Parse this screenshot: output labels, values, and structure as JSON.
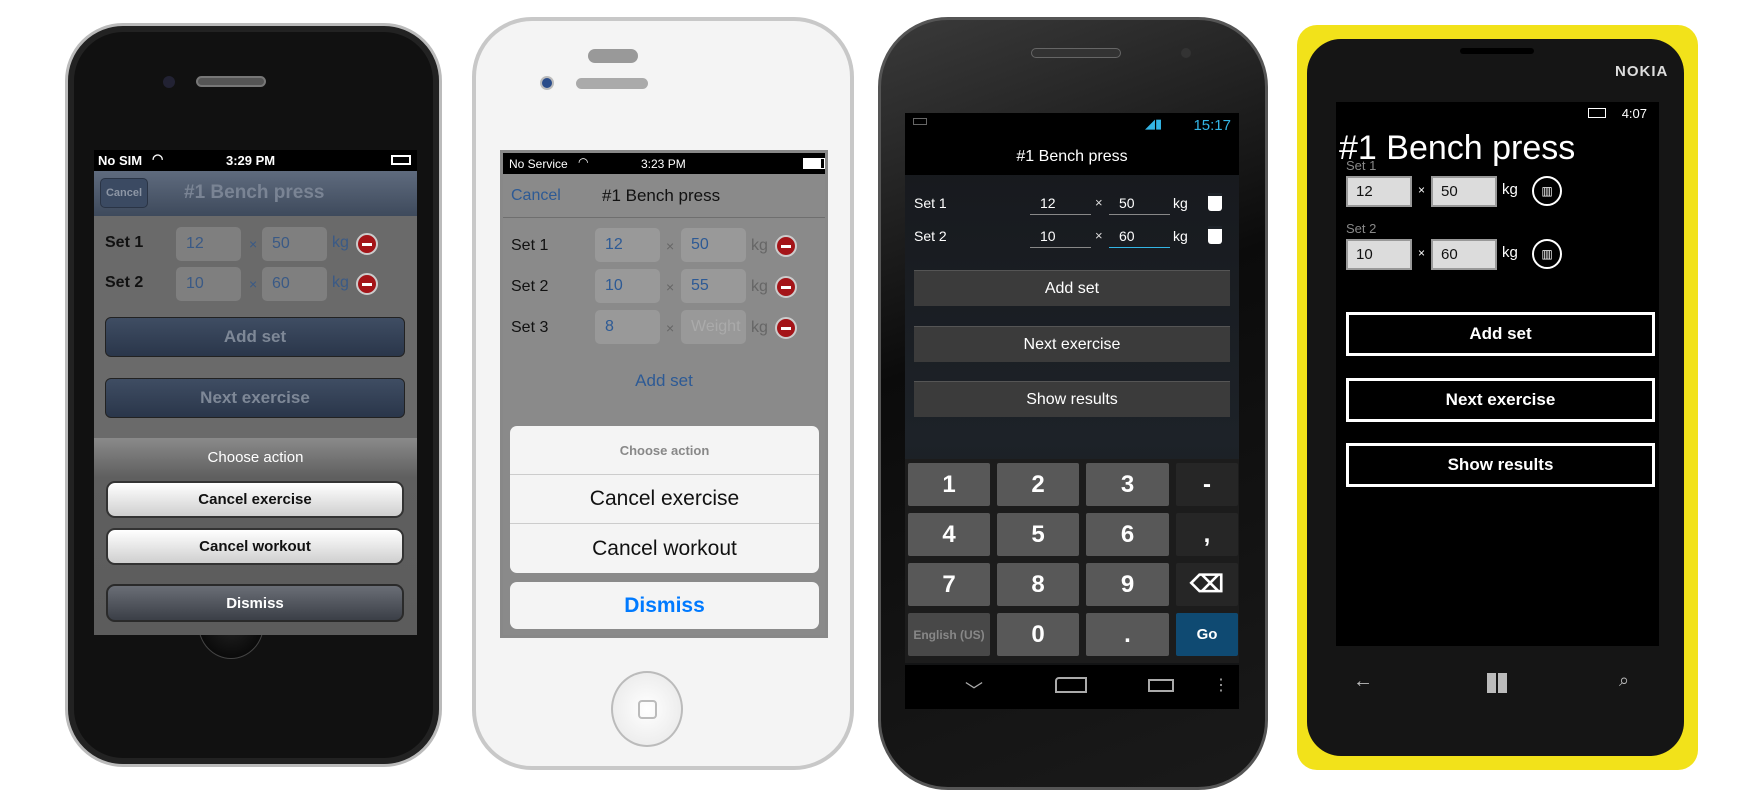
{
  "ios6": {
    "status": {
      "carrier": "No SIM",
      "time": "3:29 PM"
    },
    "nav": {
      "cancel": "Cancel",
      "title": "#1 Bench press"
    },
    "sets": [
      {
        "label": "Set 1",
        "reps": "12",
        "weight": "50"
      },
      {
        "label": "Set 2",
        "reps": "10",
        "weight": "60"
      }
    ],
    "times": "×",
    "unit": "kg",
    "add_set": "Add set",
    "next_exercise": "Next exercise",
    "sheet": {
      "title": "Choose action",
      "cancel_exercise": "Cancel exercise",
      "cancel_workout": "Cancel workout",
      "dismiss": "Dismiss"
    }
  },
  "ios7": {
    "status": {
      "carrier": "No Service",
      "time": "3:23 PM"
    },
    "nav": {
      "cancel": "Cancel",
      "title": "#1 Bench press"
    },
    "sets": [
      {
        "label": "Set 1",
        "reps": "12",
        "weight": "50"
      },
      {
        "label": "Set 2",
        "reps": "10",
        "weight": "55"
      },
      {
        "label": "Set 3",
        "reps": "8",
        "weight": "",
        "weight_placeholder": "Weight"
      }
    ],
    "times": "×",
    "unit": "kg",
    "add_set": "Add set",
    "sheet": {
      "title": "Choose action",
      "cancel_exercise": "Cancel exercise",
      "cancel_workout": "Cancel workout",
      "dismiss": "Dismiss"
    },
    "accent": "#007aff"
  },
  "android": {
    "status": {
      "time": "15:17"
    },
    "title": "#1 Bench press",
    "sets": [
      {
        "label": "Set 1",
        "reps": "12",
        "weight": "50"
      },
      {
        "label": "Set 2",
        "reps": "10",
        "weight": "60"
      }
    ],
    "times": "×",
    "unit": "kg",
    "add_set": "Add set",
    "next_exercise": "Next exercise",
    "show_results": "Show results",
    "keyboard": {
      "keys": [
        "1",
        "2",
        "3",
        "-",
        "4",
        "5",
        "6",
        ",",
        "7",
        "8",
        "9",
        "⌫",
        "English (US)",
        "0",
        ".",
        "Go"
      ]
    },
    "accent": "#33b5e5"
  },
  "wp": {
    "brand": "NOKIA",
    "status": {
      "time": "4:07"
    },
    "title": "#1 Bench press",
    "sets": [
      {
        "label": "Set 1",
        "reps": "12",
        "weight": "50"
      },
      {
        "label": "Set 2",
        "reps": "10",
        "weight": "60"
      }
    ],
    "times": "×",
    "unit": "kg",
    "add_set": "Add set",
    "next_exercise": "Next exercise",
    "show_results": "Show results",
    "nav_icons": [
      "back-icon",
      "windows-icon",
      "search-icon"
    ],
    "frame_color": "#f2e21a"
  }
}
